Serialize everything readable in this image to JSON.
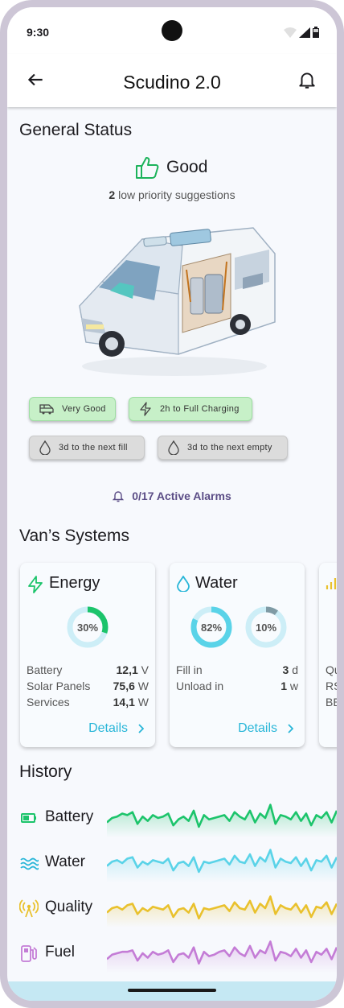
{
  "status_bar": {
    "time": "9:30"
  },
  "app_bar": {
    "title": "Scudino 2.0"
  },
  "general_status": {
    "heading": "General Status",
    "status": "Good",
    "suggestions_count": "2",
    "suggestions_text": " low priority suggestions",
    "chips": [
      "Very Good",
      "2h to Full Charging",
      "3d to the next fill",
      "3d to the next empty"
    ],
    "alarms": "0/17 Active Alarms"
  },
  "systems": {
    "heading": "Van’s Systems",
    "energy": {
      "title": "Energy",
      "percent": 30,
      "percent_label": "30%",
      "rows": [
        {
          "label": "Battery",
          "value": "12,1",
          "unit": "V"
        },
        {
          "label": "Solar Panels",
          "value": "75,6",
          "unit": "W"
        },
        {
          "label": "Services",
          "value": "14,1",
          "unit": "W"
        }
      ],
      "details": "Details"
    },
    "water": {
      "title": "Water",
      "fill_percent": 82,
      "fill_label": "82%",
      "waste_percent": 10,
      "waste_label": "10%",
      "rows": [
        {
          "label": "Fill in",
          "value": "3",
          "unit": "d"
        },
        {
          "label": "Unload in",
          "value": "1",
          "unit": "w"
        }
      ],
      "details": "Details"
    },
    "partial_card_rows": [
      "Qu",
      "RS",
      "BE"
    ]
  },
  "history": {
    "heading": "History",
    "series": [
      {
        "name": "Battery",
        "color": "#1cc46b",
        "values": [
          8,
          11,
          12,
          14,
          13,
          15,
          7,
          12,
          9,
          13,
          11,
          12,
          14,
          6,
          10,
          12,
          9,
          16,
          5,
          13,
          10,
          11,
          12,
          13,
          9,
          15,
          12,
          10,
          16,
          8,
          14,
          11,
          20,
          7,
          13,
          12,
          10,
          15,
          9,
          14,
          6,
          13,
          11,
          15,
          8,
          16
        ]
      },
      {
        "name": "Water",
        "color": "#5ad3e8",
        "values": [
          9,
          12,
          13,
          11,
          14,
          15,
          8,
          12,
          10,
          13,
          12,
          11,
          14,
          6,
          11,
          12,
          9,
          15,
          5,
          12,
          11,
          12,
          13,
          14,
          10,
          16,
          12,
          11,
          17,
          9,
          15,
          12,
          20,
          8,
          14,
          12,
          11,
          15,
          9,
          14,
          6,
          13,
          12,
          16,
          8,
          15
        ]
      },
      {
        "name": "Quality",
        "color": "#e9c12d",
        "values": [
          8,
          11,
          12,
          10,
          13,
          14,
          7,
          11,
          9,
          12,
          11,
          10,
          13,
          5,
          10,
          11,
          8,
          14,
          4,
          11,
          10,
          11,
          12,
          13,
          9,
          15,
          11,
          10,
          16,
          8,
          14,
          11,
          19,
          7,
          13,
          11,
          10,
          14,
          8,
          13,
          5,
          12,
          11,
          15,
          7,
          14
        ]
      },
      {
        "name": "Fuel",
        "color": "#c47cd6",
        "values": [
          7,
          10,
          11,
          12,
          12,
          13,
          6,
          11,
          8,
          12,
          10,
          11,
          13,
          5,
          10,
          11,
          8,
          15,
          4,
          12,
          9,
          10,
          12,
          13,
          9,
          15,
          11,
          9,
          16,
          8,
          13,
          11,
          19,
          6,
          12,
          11,
          9,
          14,
          8,
          13,
          5,
          12,
          10,
          14,
          7,
          15
        ]
      }
    ]
  }
}
